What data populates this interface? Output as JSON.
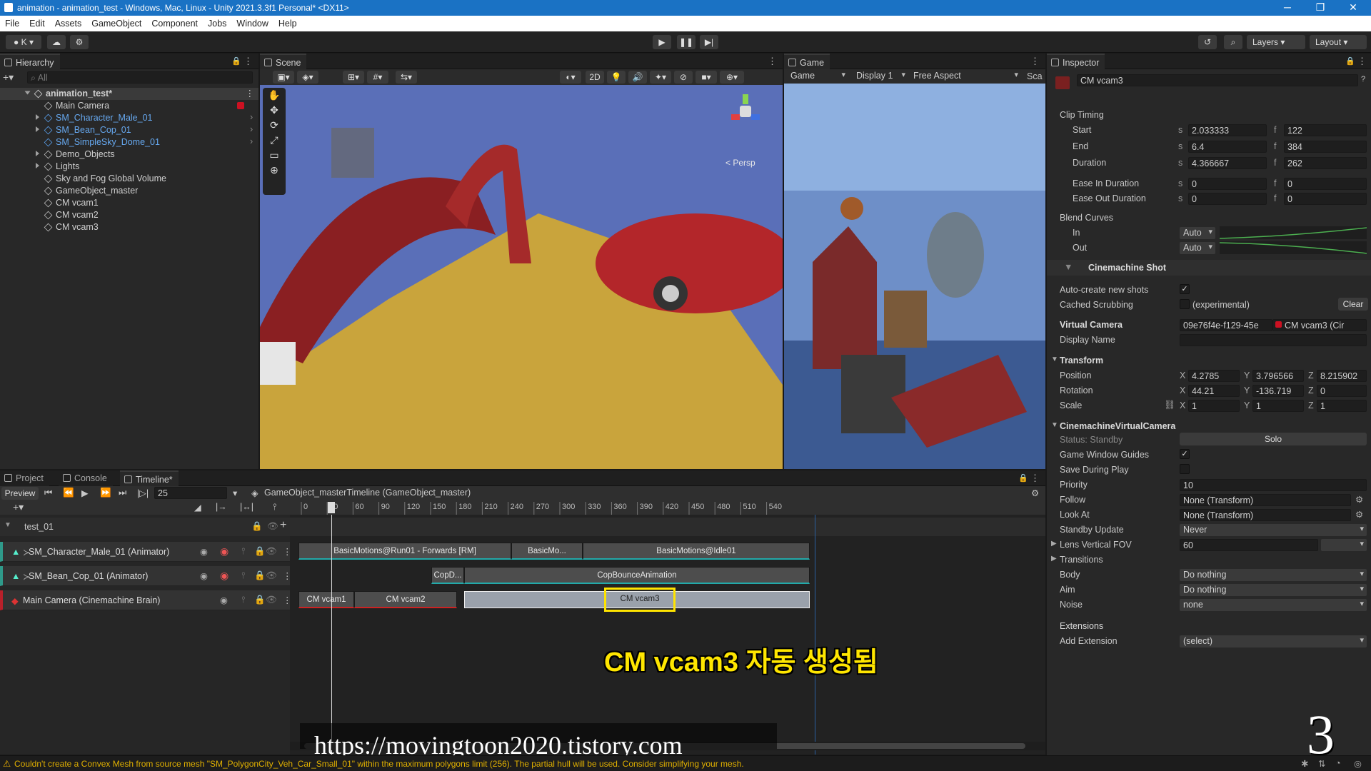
{
  "window": {
    "title": "animation - animation_test - Windows, Mac, Linux - Unity 2021.3.3f1 Personal* <DX11>",
    "minimize": "─",
    "restore": "❐",
    "close": "✕"
  },
  "menu": [
    "File",
    "Edit",
    "Assets",
    "GameObject",
    "Component",
    "Jobs",
    "Window",
    "Help"
  ],
  "toolbar": {
    "account": "K",
    "layers": "Layers",
    "layout": "Layout"
  },
  "hierarchy": {
    "tab": "Hierarchy",
    "search_placeholder": "All",
    "scene": "animation_test*",
    "items": [
      "Main Camera",
      "SM_Character_Male_01",
      "SM_Bean_Cop_01",
      "SM_SimpleSky_Dome_01",
      "Demo_Objects",
      "Lights",
      "Sky and Fog Global Volume",
      "GameObject_master",
      "CM vcam1",
      "CM vcam2",
      "CM vcam3"
    ]
  },
  "scene": {
    "tab": "Scene",
    "mode2d": "2D",
    "persp": "< Persp"
  },
  "game": {
    "tab": "Game",
    "view": "Game",
    "display": "Display 1",
    "aspect": "Free Aspect",
    "scale": "Sca"
  },
  "inspector": {
    "tab": "Inspector",
    "object_name": "CM vcam3",
    "clip_timing": "Clip Timing",
    "timing": [
      {
        "label": "Start",
        "s": "2.033333",
        "f": "122"
      },
      {
        "label": "End",
        "s": "6.4",
        "f": "384"
      },
      {
        "label": "Duration",
        "s": "4.366667",
        "f": "262"
      },
      {
        "label": "Ease In Duration",
        "s": "0",
        "f": "0"
      },
      {
        "label": "Ease Out Duration",
        "s": "0",
        "f": "0"
      }
    ],
    "s_prefix": "s",
    "f_prefix": "f",
    "blend_curves": "Blend Curves",
    "blend_in": "In",
    "blend_out": "Out",
    "auto": "Auto",
    "cm_shot": "Cinemachine Shot",
    "auto_create": "Auto-create new shots",
    "cached_scrubbing": "Cached Scrubbing",
    "experimental": "(experimental)",
    "clear": "Clear",
    "virtual_camera": "Virtual Camera",
    "vcam_id": "09e76f4e-f129-45e",
    "vcam_ref": "CM vcam3 (Cir",
    "display_name": "Display Name",
    "transform": "Transform",
    "position": "Position",
    "rotation": "Rotation",
    "scale": "Scale",
    "pos": {
      "x": "4.2785",
      "y": "3.796566",
      "z": "8.215902"
    },
    "rot": {
      "x": "44.21",
      "y": "-136.719",
      "z": "0"
    },
    "scl": {
      "x": "1",
      "y": "1",
      "z": "1"
    },
    "axis_x": "X",
    "axis_y": "Y",
    "axis_z": "Z",
    "cvc": "CinemachineVirtualCamera",
    "status": "Status: Standby",
    "solo": "Solo",
    "game_window_guides": "Game Window Guides",
    "save_during_play": "Save During Play",
    "priority_label": "Priority",
    "priority": "10",
    "follow_label": "Follow",
    "follow": "None (Transform)",
    "lookat_label": "Look At",
    "lookat": "None (Transform)",
    "standby_label": "Standby Update",
    "standby": "Never",
    "fov_label": "Lens Vertical FOV",
    "fov": "60",
    "transitions": "Transitions",
    "body_label": "Body",
    "body": "Do nothing",
    "aim_label": "Aim",
    "aim": "Do nothing",
    "noise_label": "Noise",
    "noise": "none",
    "extensions": "Extensions",
    "add_extension": "Add Extension",
    "select": "(select)"
  },
  "bottom": {
    "tabs": [
      "Project",
      "Console",
      "Timeline*"
    ],
    "preview": "Preview",
    "frame": "25",
    "asset": "GameObject_masterTimeline (GameObject_master)",
    "ticks": [
      "0",
      "30",
      "60",
      "90",
      "120",
      "150",
      "180",
      "210",
      "240",
      "270",
      "300",
      "330",
      "360",
      "390",
      "420",
      "450",
      "480",
      "510",
      "540"
    ],
    "group": "test_01",
    "tracks": [
      "SM_Character_Male_01 (Animator)",
      "SM_Bean_Cop_01 (Animator)",
      "Main Camera (Cinemachine Brain)"
    ],
    "clips": {
      "run": "BasicMotions@Run01 - Forwards [RM]",
      "basic_mo": "BasicMo...",
      "idle": "BasicMotions@Idle01",
      "copd": "CopD...",
      "copbounce": "CopBounceAnimation",
      "vcam1": "CM vcam1",
      "vcam2": "CM vcam2",
      "vcam3": "CM vcam3"
    }
  },
  "overlay": {
    "caption": "CM vcam3 자동 생성됨",
    "url": "https://movingtoon2020.tistory.com",
    "step": "3"
  },
  "status": {
    "message": "Couldn't create a Convex Mesh from source mesh \"SM_PolygonCity_Veh_Car_Small_01\" within the maximum polygons limit (256). The partial hull will be used. Consider simplifying your mesh."
  }
}
